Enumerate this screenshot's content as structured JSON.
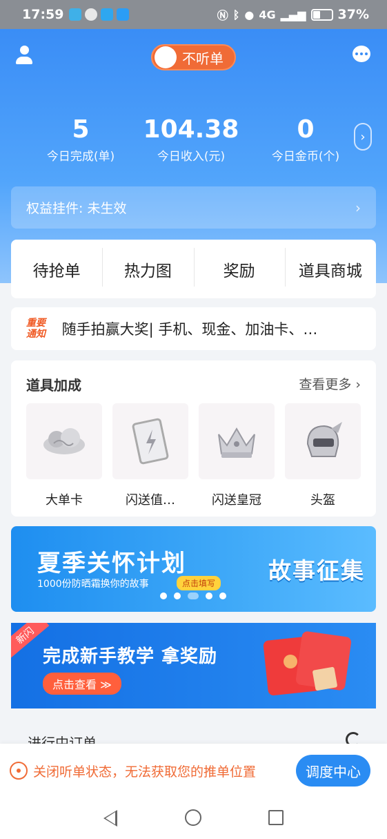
{
  "status_bar": {
    "time": "17:59",
    "network": "4G",
    "battery_pct": "37%",
    "battery_level": 0.37
  },
  "header": {
    "toggle_label": "不听单",
    "stats": [
      {
        "value": "5",
        "label": "今日完成(单)"
      },
      {
        "value": "104.38",
        "label": "今日收入(元)"
      },
      {
        "value": "0",
        "label": "今日金币(个)"
      }
    ],
    "rights_label": "权益挂件:  未生效"
  },
  "tabs": [
    {
      "label": "待抢单"
    },
    {
      "label": "热力图"
    },
    {
      "label": "奖励"
    },
    {
      "label": "道具商城"
    }
  ],
  "notice": {
    "badge": "重要\n通知",
    "text": "随手拍赢大奖| 手机、现金、加油卡、…"
  },
  "props": {
    "title": "道具加成",
    "more": "查看更多 ›",
    "items": [
      {
        "label": "大单卡"
      },
      {
        "label": "闪送值…"
      },
      {
        "label": "闪送皇冠"
      },
      {
        "label": "头盔"
      }
    ]
  },
  "banner1": {
    "title": "夏季关怀计划",
    "subtitle": "1000份防晒霜换你的故事",
    "button": "点击填写",
    "right_text": "故事征集"
  },
  "banner2": {
    "corner": "新闪",
    "title": "完成新手教学 拿奖励",
    "button": "点击查看 ≫"
  },
  "ongoing_title": "进行中订单",
  "dispatch": {
    "message": "关闭听单状态，无法获取您的推单位置",
    "button": "调度中心"
  }
}
